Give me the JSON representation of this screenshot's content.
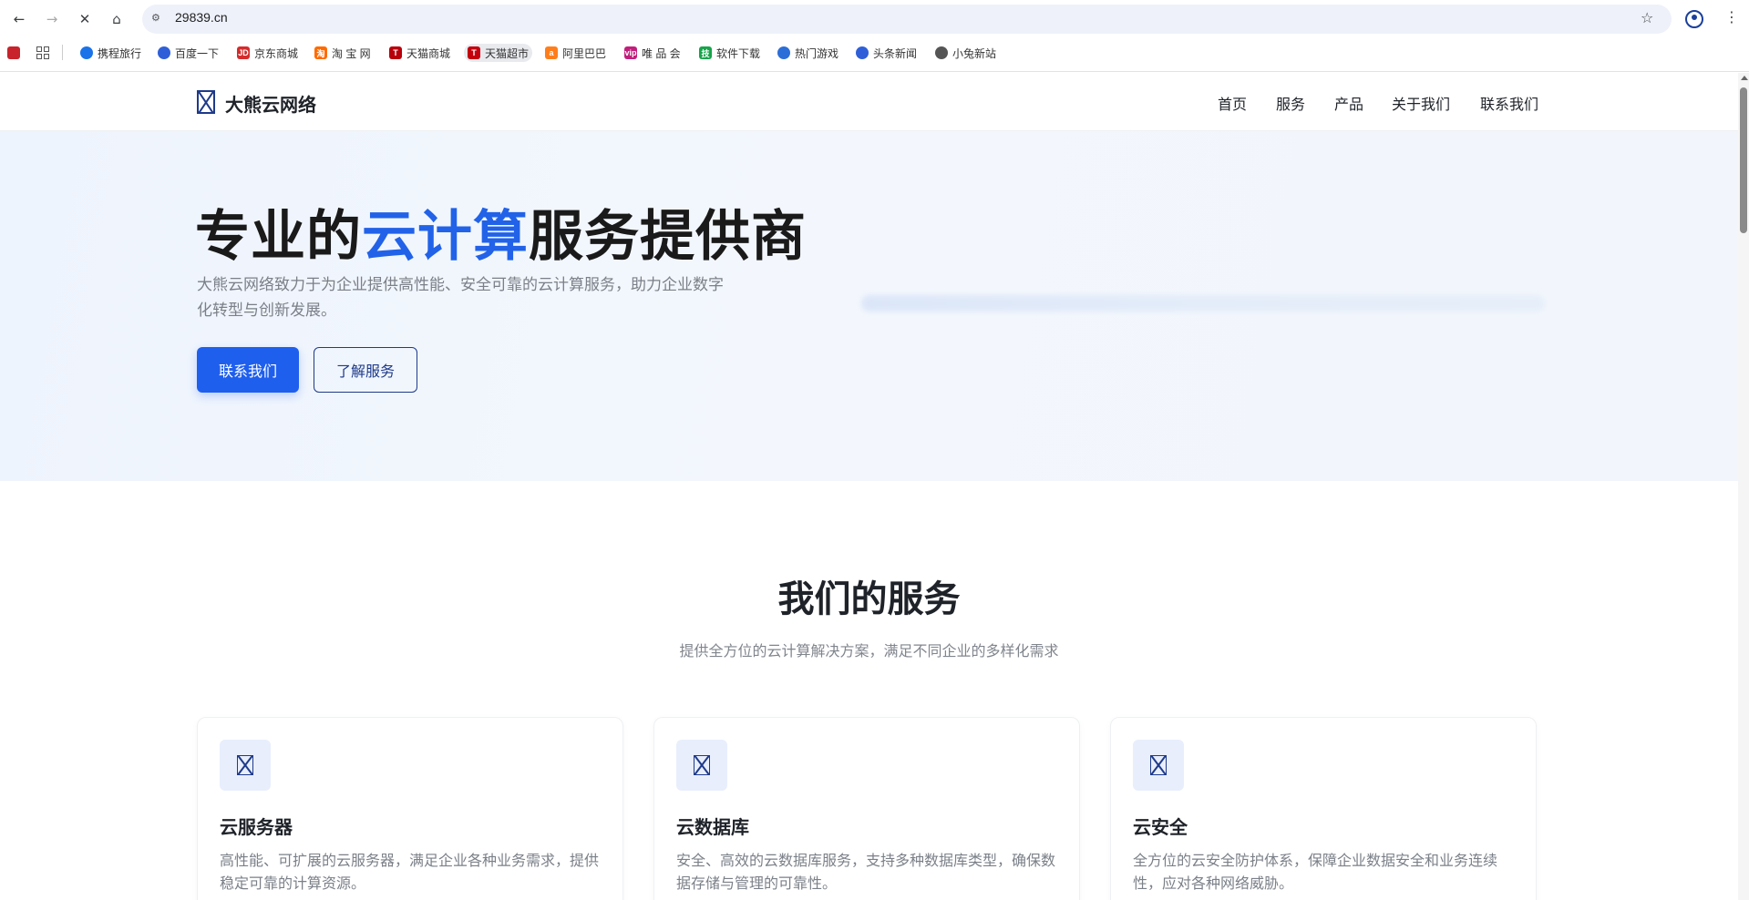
{
  "browser": {
    "url": "29839.cn",
    "bookmarks": [
      {
        "label": "携程旅行",
        "color": "#1a73e8"
      },
      {
        "label": "百度一下",
        "color": "#2f5fd8"
      },
      {
        "label": "京东商城",
        "color": "#d52b2b",
        "icon_text": "JD"
      },
      {
        "label": "淘 宝 网",
        "color": "#ff6a00",
        "icon_text": "淘"
      },
      {
        "label": "天猫商城",
        "color": "#b8000b",
        "icon_text": "T"
      },
      {
        "label": "天猫超市",
        "color": "#c4000e",
        "icon_text": "T"
      },
      {
        "label": "阿里巴巴",
        "color": "#ff7e1b",
        "icon_text": "a"
      },
      {
        "label": "唯 品 会",
        "color": "#c11e7c",
        "icon_text": "vip"
      },
      {
        "label": "软件下载",
        "color": "#17a34a",
        "icon_text": "技"
      },
      {
        "label": "热门游戏",
        "color": "#2c6ed8"
      },
      {
        "label": "头条新闻",
        "color": "#2f5fd8"
      },
      {
        "label": "小兔新站",
        "color": "#555555"
      }
    ]
  },
  "site": {
    "logo_text": "大熊云网络",
    "nav": [
      "首页",
      "服务",
      "产品",
      "关于我们",
      "联系我们"
    ]
  },
  "hero": {
    "title_prefix": "专业的",
    "title_highlight": "云计算",
    "title_suffix": "服务提供商",
    "description": "大熊云网络致力于为企业提供高性能、安全可靠的云计算服务，助力企业数字化转型与创新发展。",
    "primary_button": "联系我们",
    "secondary_button": "了解服务"
  },
  "services": {
    "title": "我们的服务",
    "subtitle": "提供全方位的云计算解决方案，满足不同企业的多样化需求",
    "cards": [
      {
        "title": "云服务器",
        "desc": "高性能、可扩展的云服务器，满足企业各种业务需求，提供稳定可靠的计算资源。"
      },
      {
        "title": "云数据库",
        "desc": "安全、高效的云数据库服务，支持多种数据库类型，确保数据存储与管理的可靠性。"
      },
      {
        "title": "云安全",
        "desc": "全方位的云安全防护体系，保障企业数据安全和业务连续性，应对各种网络威胁。"
      }
    ]
  },
  "colors": {
    "accent": "#2162e8",
    "primary_button": "#1f5fee",
    "logo": "#1e3a8a"
  }
}
